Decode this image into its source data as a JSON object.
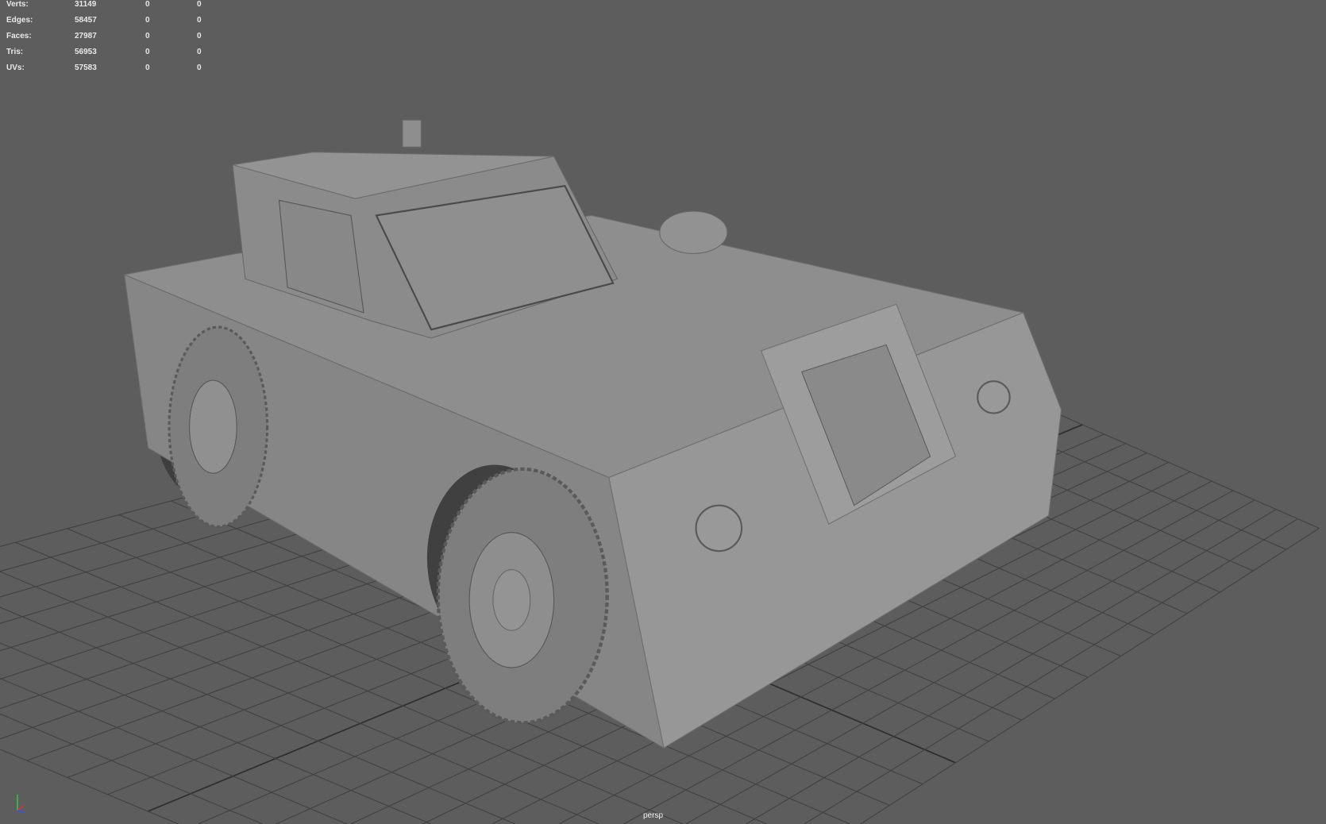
{
  "heads_up": {
    "rows": [
      {
        "label": "Verts:",
        "total": "31149",
        "selected": "0",
        "sel2": "0"
      },
      {
        "label": "Edges:",
        "total": "58457",
        "selected": "0",
        "sel2": "0"
      },
      {
        "label": "Faces:",
        "total": "27987",
        "selected": "0",
        "sel2": "0"
      },
      {
        "label": "Tris:",
        "total": "56953",
        "selected": "0",
        "sel2": "0"
      },
      {
        "label": "UVs:",
        "total": "57583",
        "selected": "0",
        "sel2": "0"
      }
    ]
  },
  "camera": {
    "name": "persp"
  },
  "colors": {
    "background": "#5d5d5d",
    "grid": "#404040",
    "model": "#8c8c8c"
  }
}
